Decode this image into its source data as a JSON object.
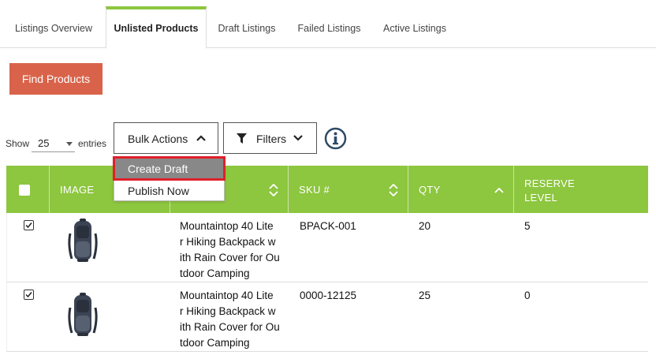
{
  "tabs": [
    {
      "label": "Listings Overview"
    },
    {
      "label": "Unlisted Products"
    },
    {
      "label": "Draft Listings"
    },
    {
      "label": "Failed Listings"
    },
    {
      "label": "Active Listings"
    }
  ],
  "active_tab": "Unlisted Products",
  "find_button": "Find Products",
  "entries": {
    "show": "Show",
    "value": "25",
    "suffix": "entries"
  },
  "bulk_actions": {
    "label": "Bulk Actions",
    "open": true,
    "items": [
      {
        "label": "Create Draft",
        "highlighted": true
      },
      {
        "label": "Publish Now",
        "highlighted": false
      }
    ]
  },
  "filters": {
    "label": "Filters"
  },
  "info_icon": "info-circle-icon",
  "table": {
    "headers": {
      "image": "IMAGE",
      "sku": "SKU #",
      "qty": "QTY",
      "reserve": "RESERVE LEVEL",
      "reserve_line1": "RESERVE",
      "reserve_line2": "LEVEL"
    },
    "rows": [
      {
        "checked": true,
        "image": "backpack-image",
        "title": "Mountaintop 40 Liter Hiking Backpack with Rain Cover for Outdoor Camping",
        "title_lines": [
          "Mountaintop 40 Lite",
          "r Hiking Backpack w",
          "ith Rain Cover for Ou",
          "tdoor Camping"
        ],
        "sku": "BPACK-001",
        "qty": "20",
        "reserve": "5"
      },
      {
        "checked": true,
        "image": "backpack-image",
        "title": "Mountaintop 40 Liter Hiking Backpack with Rain Cover for Outdoor Camping",
        "title_lines": [
          "Mountaintop 40 Lite",
          "r Hiking Backpack w",
          "ith Rain Cover for Ou",
          "tdoor Camping"
        ],
        "sku": "0000-12125",
        "qty": "25",
        "reserve": "0"
      }
    ]
  },
  "colors": {
    "accent_green": "#8dc63f",
    "find_button": "#d9634a",
    "highlight_outline": "#e0202a",
    "info_icon": "#2d4a66"
  }
}
